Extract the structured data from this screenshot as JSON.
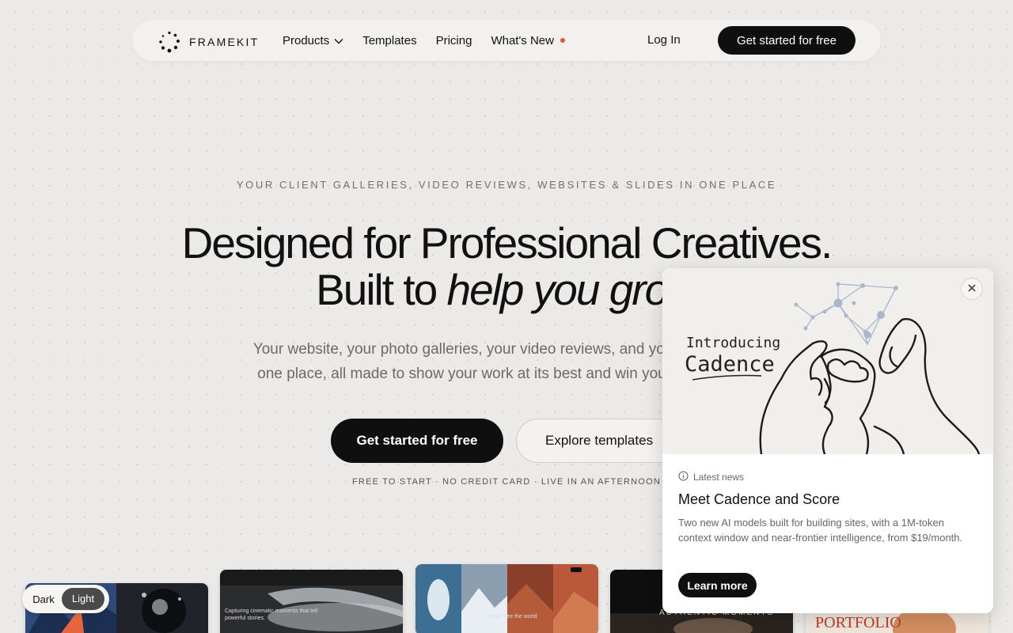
{
  "nav": {
    "brand": "FRAMEKIT",
    "links": [
      {
        "label": "Products",
        "has_dropdown": true
      },
      {
        "label": "Templates"
      },
      {
        "label": "Pricing"
      },
      {
        "label": "What's New",
        "has_dot": true
      }
    ],
    "login": "Log In",
    "cta": "Get started for free"
  },
  "hero": {
    "eyebrow": "YOUR CLIENT GALLERIES, VIDEO REVIEWS, WEBSITES & SLIDES IN ONE PLACE",
    "headline_line1": "Designed for Professional Creatives.",
    "headline_line2_plain": "Built to ",
    "headline_line2_italic": "help you grow",
    "sub_line1": "Your website, your photo galleries, your video reviews, and your slides, all in",
    "sub_line2": "one place, all made to show your work at its best and win you more clients.",
    "cta_primary": "Get started for free",
    "cta_secondary": "Explore templates",
    "reassurance": "FREE TO START · NO CREDIT CARD · LIVE IN AN AFTERNOON"
  },
  "templates": {
    "t2_caption": "Capturing cinematic moments that tell powerful stories.",
    "t3_caption": "How I see the world",
    "t4_caption": "AUTHENTIC MOMENTS",
    "t5_caption": "PORTFOLIO"
  },
  "theme_toggle": {
    "dark": "Dark",
    "light": "Light",
    "active": "Light"
  },
  "news_popup": {
    "art_line1": "Introducing",
    "art_line2": "Cadence",
    "tag": "Latest news",
    "title": "Meet Cadence and Score",
    "description": "Two new AI models built for building sites, with a 1M-token context window and near-frontier intelligence, from $19/month.",
    "button": "Learn more"
  },
  "colors": {
    "background": "#ebeae8",
    "primary_button": "#0f0f0f",
    "accent_dot": "#e8552e",
    "network_node": "#a9b6cc"
  },
  "icons": [
    "logo-mark-icon",
    "chevron-down-icon",
    "close-icon",
    "info-icon"
  ]
}
